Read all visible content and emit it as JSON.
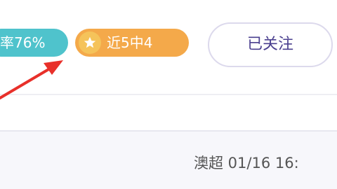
{
  "badges": {
    "win_rate": "率76%",
    "recent_form": "近5中4",
    "recent_icon": "star-icon"
  },
  "follow_button": {
    "label": "已关注"
  },
  "match": {
    "info": "澳超 01/16 16:"
  },
  "colors": {
    "win_rate_badge": "#4fc3cc",
    "recent_badge": "#f4a94a",
    "recent_icon_bg": "#f5c35a",
    "follow_text": "#4a3f8f",
    "follow_border": "#dcd9ec",
    "annotation": "#e8302a",
    "bottom_bg": "#f7f7fb"
  }
}
